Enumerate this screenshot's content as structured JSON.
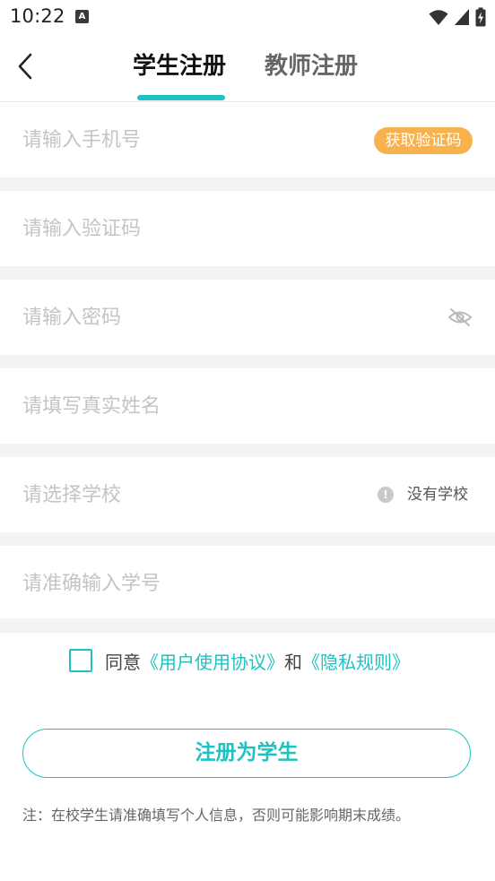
{
  "status_bar": {
    "time": "10:22",
    "notification_icon": "A"
  },
  "nav": {
    "tabs": [
      {
        "label": "学生注册",
        "active": true
      },
      {
        "label": "教师注册",
        "active": false
      }
    ],
    "accent_color": "#1ec2c0"
  },
  "form": {
    "phone": {
      "placeholder": "请输入手机号",
      "get_code_label": "获取验证码"
    },
    "code": {
      "placeholder": "请输入验证码"
    },
    "password": {
      "placeholder": "请输入密码"
    },
    "name": {
      "placeholder": "请填写真实姓名"
    },
    "school": {
      "placeholder": "请选择学校",
      "no_school_label": "没有学校",
      "info_glyph": "!"
    },
    "student_id": {
      "placeholder": "请准确输入学号"
    }
  },
  "agreement": {
    "prefix": "同意",
    "user_agreement": "《用户使用协议》",
    "conjunction": "和",
    "privacy": "《隐私规则》"
  },
  "submit_label": "注册为学生",
  "note": "注：在校学生请准确填写个人信息，否则可能影响期末成绩。",
  "colors": {
    "accent": "#1ec2c0",
    "code_button": "#f7b24d",
    "divider": "#f2f3f5"
  }
}
